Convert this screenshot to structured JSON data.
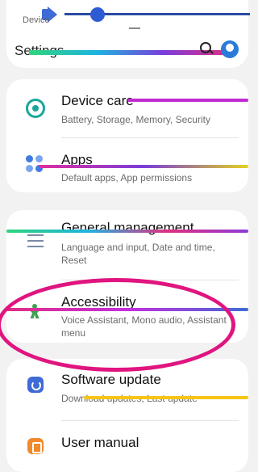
{
  "volume_panel": {
    "device_label": "Device",
    "level": 0.18
  },
  "header": {
    "title": "Settings"
  },
  "cards": [
    {
      "items": [
        {
          "title": "Device care",
          "subtitle": "Battery, Storage, Memory, Security",
          "icon": "device-care-icon"
        },
        {
          "title": "Apps",
          "subtitle": "Default apps, App permissions",
          "icon": "apps-icon"
        }
      ]
    },
    {
      "items": [
        {
          "title": "General management",
          "subtitle": "Language and input, Date and time, Reset",
          "icon": "general-management-icon"
        },
        {
          "title": "Accessibility",
          "subtitle": "Voice Assistant, Mono audio, Assistant menu",
          "icon": "accessibility-icon"
        }
      ]
    },
    {
      "items": [
        {
          "title": "Software update",
          "subtitle": "Download updates, Last update",
          "icon": "software-update-icon"
        },
        {
          "title": "User manual",
          "subtitle": "",
          "icon": "user-manual-icon"
        }
      ]
    }
  ],
  "colors": {
    "accent_highlight": "#e0157f",
    "background": "#f2f2f2"
  }
}
